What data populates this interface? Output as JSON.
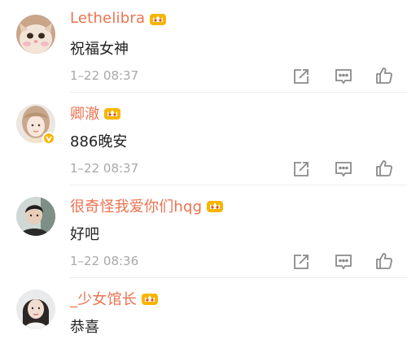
{
  "comments": [
    {
      "username": "Lethelibra",
      "text": "祝福女神",
      "time": "1–22 08:37",
      "avatar": "kitten-avatar",
      "verified": false
    },
    {
      "username": "卿澈",
      "text": "886晚安",
      "time": "1–22 08:37",
      "avatar": "girl-avatar",
      "verified": true
    },
    {
      "username": "很奇怪我爱你们hqg",
      "text": "好吧",
      "time": "1–22 08:36",
      "avatar": "boy-avatar",
      "verified": false
    },
    {
      "username": "_少女馆长",
      "text": "恭喜",
      "time": "",
      "avatar": "woman-avatar",
      "verified": false
    }
  ],
  "icons": {
    "member_badge": "crown-badge-icon",
    "repost": "repost-icon",
    "comment": "comment-icon",
    "like": "thumbs-up-icon",
    "verified": "verified-v-icon"
  },
  "colors": {
    "username": "#eb7350",
    "text": "#222222",
    "time": "#a8a8a8",
    "icons": "#8a8a8a",
    "divider": "#ececec",
    "badge": "#f7b500"
  }
}
